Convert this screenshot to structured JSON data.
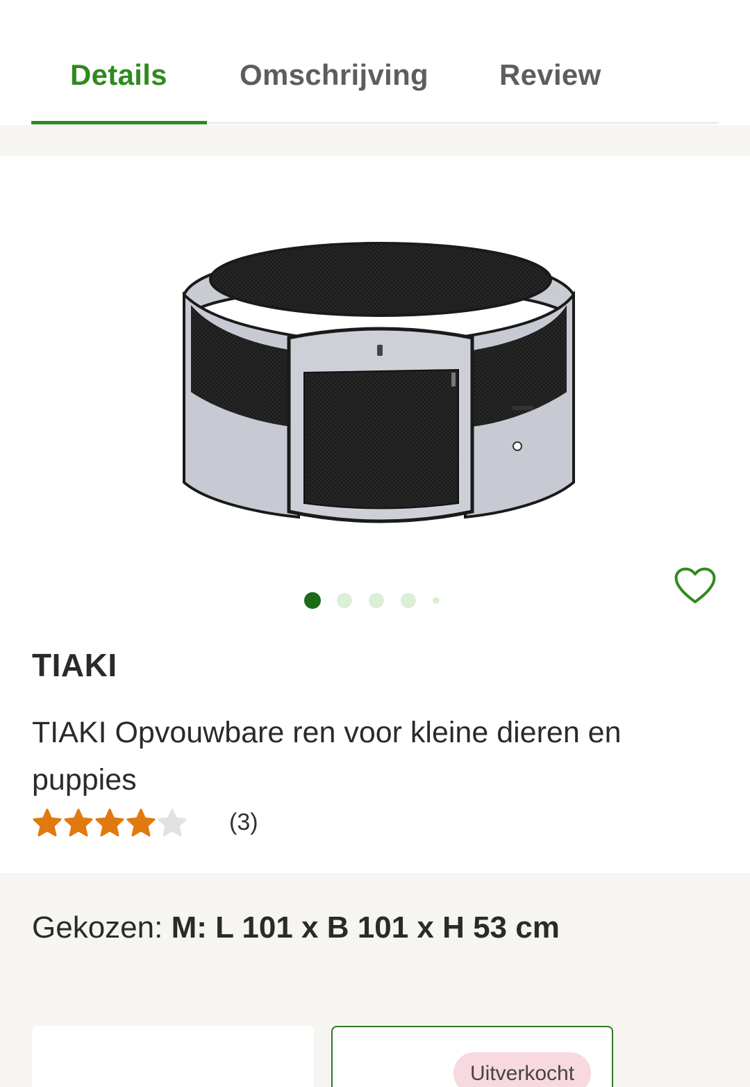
{
  "tabs": [
    {
      "label": "Details",
      "active": true
    },
    {
      "label": "Omschrijving",
      "active": false
    },
    {
      "label": "Review",
      "active": false
    }
  ],
  "colors": {
    "accent": "#2f8a1e",
    "dot_active": "#1d6b16",
    "dot_inactive": "#dcefd6",
    "star_filled": "#e07a10",
    "star_empty": "#e2e2e2",
    "section_bg": "#f6f5f2"
  },
  "product_image": {
    "icon": "playpen-image",
    "slide_index": 1,
    "slide_count": 5
  },
  "favorite": {
    "icon": "heart-icon"
  },
  "product": {
    "brand": "TIAKI",
    "title": "TIAKI Opvouwbare ren voor kleine dieren en puppies",
    "rating": 4,
    "rating_max": 5,
    "review_count": "(3)"
  },
  "chosen": {
    "label": "Gekozen:",
    "value": "M: L 101 x B 101 x H 53 cm"
  },
  "variants": [
    {
      "badge": ""
    },
    {
      "badge": "Uitverkocht"
    }
  ]
}
